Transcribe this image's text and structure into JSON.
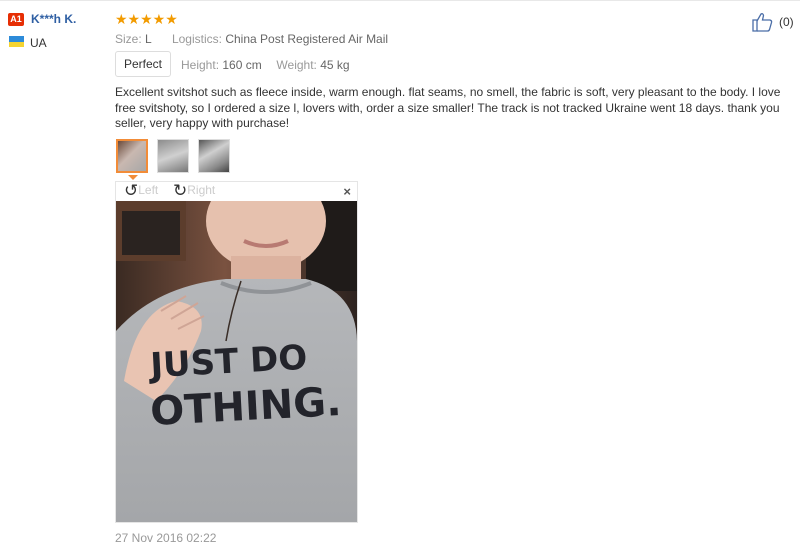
{
  "user": {
    "badge": "A1",
    "name": "K***h K.",
    "country": "UA"
  },
  "review": {
    "stars": "★★★★★",
    "size_label": "Size:",
    "size_value": "L",
    "logistics_label": "Logistics:",
    "logistics_value": "China Post Registered Air Mail",
    "rating_label": "Perfect",
    "height_label": "Height:",
    "height_value": "160 cm",
    "weight_label": "Weight:",
    "weight_value": "45 kg",
    "text": "Excellent svitshot such as fleece inside, warm enough. flat seams, no smell, the fabric is soft, very pleasant to the body. I love free svitshoty, so I ordered a size l, lovers with, order a size smaller! The track is not tracked Ukraine went 18 days. thank you seller, very happy with purchase!",
    "date": "27 Nov 2016 02:22"
  },
  "viewer": {
    "rotate_left": "Left",
    "rotate_right": "Right",
    "close": "×",
    "photo_text_line1": "JUST DO",
    "photo_text_line2": "OTHING."
  },
  "like": {
    "count": "(0)"
  },
  "colors": {
    "accent": "#f28c38",
    "star": "#f29b00",
    "badge": "#e62e04",
    "username": "#2f5fa3"
  }
}
